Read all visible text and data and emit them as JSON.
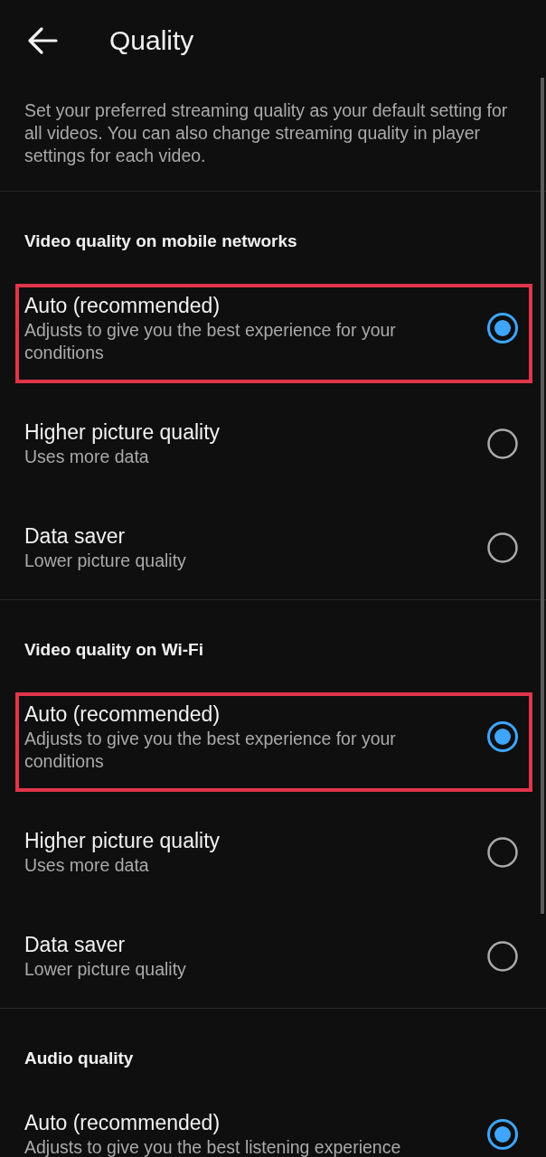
{
  "header": {
    "title": "Quality"
  },
  "description": "Set your preferred streaming quality as your default setting for all videos. You can also change streaming quality in player settings for each video.",
  "sections": [
    {
      "title": "Video quality on mobile networks",
      "options": [
        {
          "label": "Auto (recommended)",
          "subtitle": "Adjusts to give you the best experience for your conditions",
          "selected": true,
          "highlighted": true
        },
        {
          "label": "Higher picture quality",
          "subtitle": "Uses more data",
          "selected": false,
          "highlighted": false
        },
        {
          "label": "Data saver",
          "subtitle": "Lower picture quality",
          "selected": false,
          "highlighted": false
        }
      ]
    },
    {
      "title": "Video quality on Wi-Fi",
      "options": [
        {
          "label": "Auto (recommended)",
          "subtitle": "Adjusts to give you the best experience for your conditions",
          "selected": true,
          "highlighted": true
        },
        {
          "label": "Higher picture quality",
          "subtitle": "Uses more data",
          "selected": false,
          "highlighted": false
        },
        {
          "label": "Data saver",
          "subtitle": "Lower picture quality",
          "selected": false,
          "highlighted": false
        }
      ]
    },
    {
      "title": "Audio quality",
      "options": [
        {
          "label": "Auto (recommended)",
          "subtitle": "Adjusts to give you the best listening experience",
          "selected": true,
          "highlighted": false
        }
      ]
    }
  ]
}
